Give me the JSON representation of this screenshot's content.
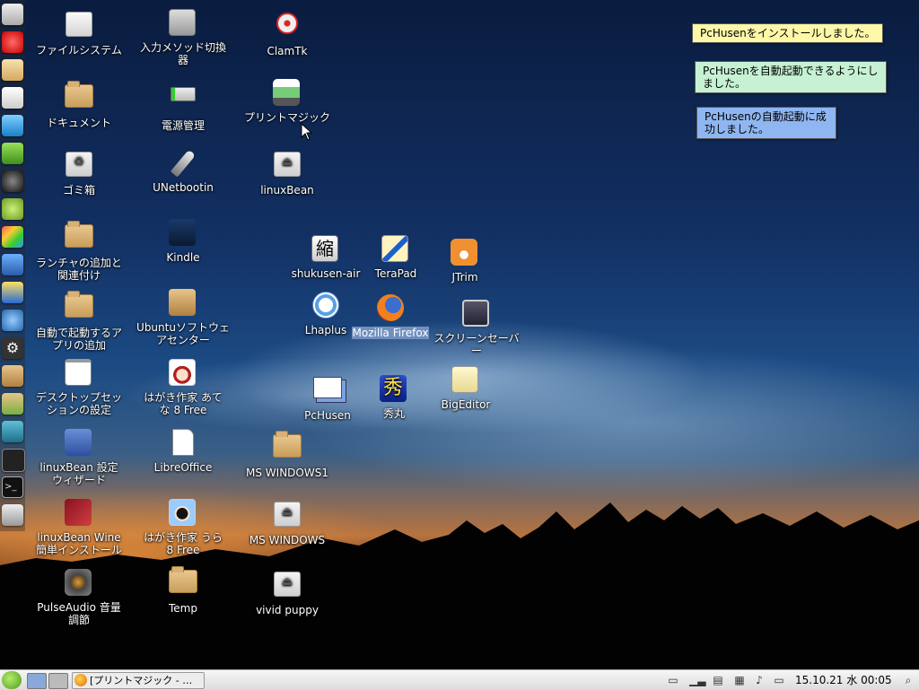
{
  "desktop": {
    "icons": [
      {
        "label": "ファイルシステム",
        "kind": "drive-icon"
      },
      {
        "label": "ドキュメント",
        "kind": "folder-icon"
      },
      {
        "label": "ゴミ箱",
        "kind": "trash-icon"
      },
      {
        "label": "ランチャの追加と関連付け",
        "kind": "folder-gear-icon"
      },
      {
        "label": "自動で起動するアプリの追加",
        "kind": "folder-gear-icon"
      },
      {
        "label": "デスクトップセッションの設定",
        "kind": "window-icon"
      },
      {
        "label": "linuxBean 設定ウィザード",
        "kind": "checkbox-app-icon"
      },
      {
        "label": "linuxBean Wine簡単インストール",
        "kind": "wine-icon"
      },
      {
        "label": "PulseAudio 音量調節",
        "kind": "speaker-icon"
      },
      {
        "label": "入力メソッド切換器",
        "kind": "keyboard-icon"
      },
      {
        "label": "電源管理",
        "kind": "battery-icon"
      },
      {
        "label": "UNetbootin",
        "kind": "rocket-icon"
      },
      {
        "label": "Kindle",
        "kind": "kindle-icon"
      },
      {
        "label": "Ubuntuソフトウェアセンター",
        "kind": "package-icon"
      },
      {
        "label": "はがき作家 あてな 8 Free",
        "kind": "hagaki-atena-icon"
      },
      {
        "label": "LibreOffice",
        "kind": "document-icon"
      },
      {
        "label": "はがき作家 うら 8 Free",
        "kind": "hagaki-ura-icon"
      },
      {
        "label": "Temp",
        "kind": "folder-icon"
      },
      {
        "label": "ClamTk",
        "kind": "target-icon"
      },
      {
        "label": "プリントマジック",
        "kind": "printer-icon"
      },
      {
        "label": "linuxBean",
        "kind": "drive-icon"
      },
      {
        "label": "MS WINDOWS1",
        "kind": "folder-icon"
      },
      {
        "label": "MS WINDOWS",
        "kind": "drive-icon"
      },
      {
        "label": "vivid puppy",
        "kind": "drive-icon"
      },
      {
        "label": "shukusen-air",
        "kind": "shukusen-icon"
      },
      {
        "label": "TeraPad",
        "kind": "terapad-icon"
      },
      {
        "label": "JTrim",
        "kind": "jtrim-icon"
      },
      {
        "label": "Lhaplus",
        "kind": "lhaplus-icon"
      },
      {
        "label": "Mozilla Firefox",
        "kind": "firefox-icon"
      },
      {
        "label": "スクリーンセーバー",
        "kind": "screensaver-icon"
      },
      {
        "label": "PcHusen",
        "kind": "pchusen-icon"
      },
      {
        "label": "秀丸",
        "kind": "hidemaru-icon"
      },
      {
        "label": "BigEditor",
        "kind": "bigeditor-icon"
      }
    ],
    "shukusen_glyph": "縮",
    "hidemaru_glyph": "秀"
  },
  "notes": [
    {
      "text": "PcHusenをインストールしました。",
      "color": "#fdf7a8"
    },
    {
      "text": "PcHusenを自動起動できるようにしました。",
      "color": "#c6f2d3"
    },
    {
      "text": "PcHusenの自動起動に成功しました。",
      "color": "#8fb6f0"
    }
  ],
  "dock": [
    "file-manager-icon",
    "opera-icon",
    "mail-icon",
    "text-editor-icon",
    "translate-icon",
    "green-app-icon",
    "camera-icon",
    "bean-icon",
    "paint-icon",
    "image-viewer-icon",
    "weather-icon",
    "network-icon",
    "settings-gear-icon",
    "package-icon",
    "package-install-icon",
    "network-share-icon",
    "system-monitor-icon",
    "terminal-icon",
    "trash-icon"
  ],
  "taskbar": {
    "task_label": "[プリントマジック - …",
    "clock": "15.10.21 水 00:05"
  },
  "colors": {
    "selection": "#6f8fbf",
    "taskbar": "#e6e6e6"
  }
}
